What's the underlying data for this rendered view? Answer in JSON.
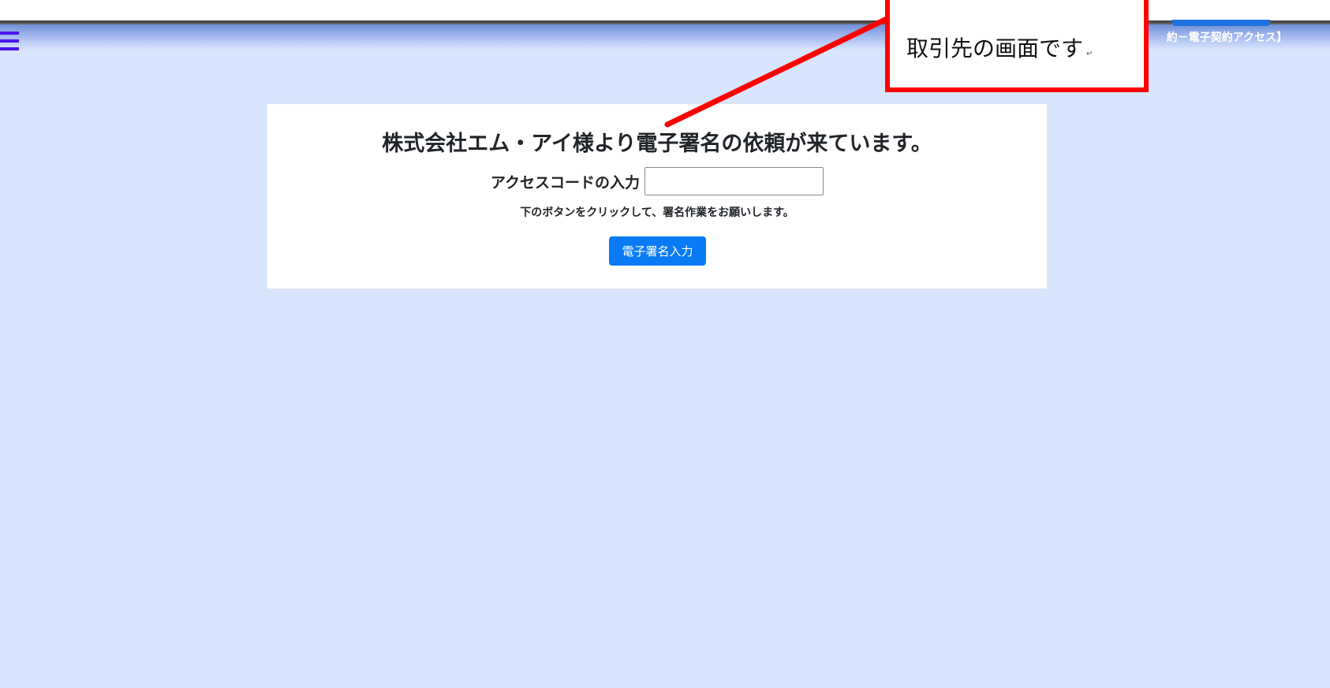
{
  "header": {
    "title": "約－電子契約アクセス】"
  },
  "card": {
    "title": "株式会社エム・アイ様より電子署名の依頼が来ています。",
    "access_code_label": "アクセスコードの入力",
    "access_code_value": "",
    "instruction": "下のボタンをクリックして、署名作業をお願いします。",
    "sign_button_label": "電子署名入力"
  },
  "annotation": {
    "text": "取引先の画面です",
    "mark": "↵",
    "color": "#ff0000"
  },
  "colors": {
    "page_background": "#d9e4fd",
    "header_gradient_top": "#6f8fd6",
    "hamburger": "#4b16e8",
    "primary_button": "#0a7bf5"
  },
  "icons": {
    "menu": "hamburger-menu-icon"
  }
}
